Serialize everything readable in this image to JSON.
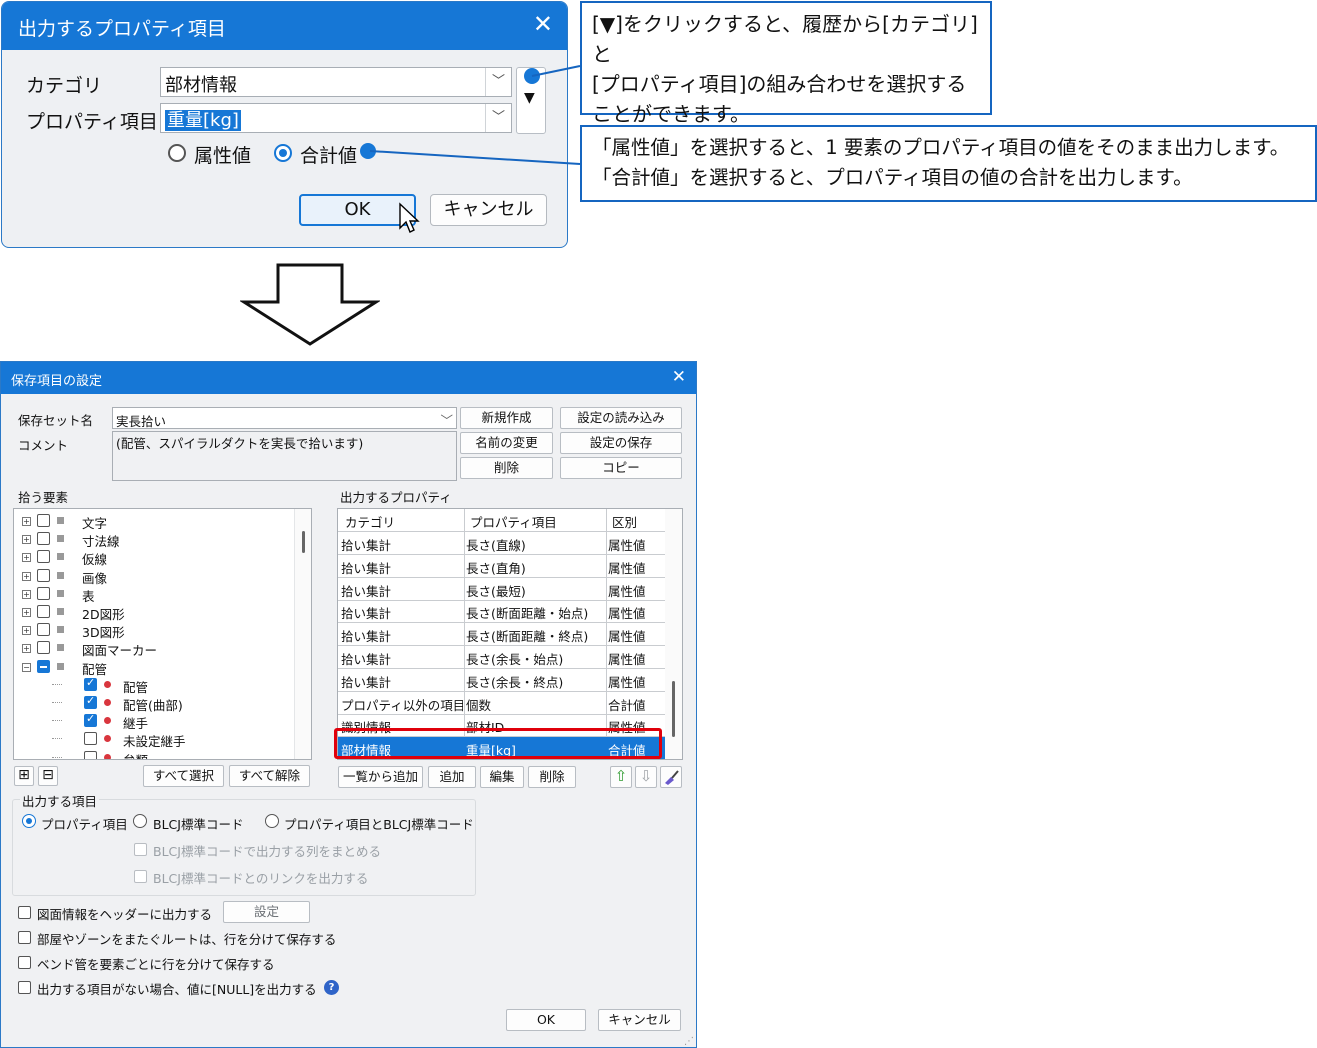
{
  "top_dialog": {
    "title": "出力するプロパティ項目",
    "close_glyph": "✕",
    "category_label": "カテゴリ",
    "category_value": "部材情報",
    "property_label": "プロパティ項目",
    "property_value": "重量[kg]",
    "history_arrow": "▼",
    "radio_attribute": "属性値",
    "radio_total": "合計値",
    "selected_radio": "合計値",
    "ok_label": "OK",
    "cancel_label": "キャンセル"
  },
  "callouts": {
    "history_line1": "[▼]をクリックすると、履歴から[カテゴリ]と",
    "history_line2": "[プロパティ項目]の組み合わせを選択する",
    "history_line3": "ことができます。",
    "total_line1": "「属性値」を選択すると、1 要素のプロパティ項目の値をそのまま出力します。",
    "total_line2": "「合計値」を選択すると、プロパティ項目の値の合計を出力します。"
  },
  "main_dialog": {
    "title": "保存項目の設定",
    "close_glyph": "✕",
    "save_set_label": "保存セット名",
    "save_set_value": "実長拾い",
    "comment_label": "コメント",
    "comment_value": "(配管、スパイラルダクトを実長で拾います)",
    "buttons": {
      "new": "新規作成",
      "load": "設定の読み込み",
      "rename": "名前の変更",
      "save_settings": "設定の保存",
      "delete": "削除",
      "copy": "コピー"
    },
    "pick_elements_label": "拾う要素",
    "tree": [
      {
        "label": "文字",
        "state": "off",
        "expander": "+"
      },
      {
        "label": "寸法線",
        "state": "off",
        "expander": "+"
      },
      {
        "label": "仮線",
        "state": "off",
        "expander": "+"
      },
      {
        "label": "画像",
        "state": "off",
        "expander": "+"
      },
      {
        "label": "表",
        "state": "off",
        "expander": "+"
      },
      {
        "label": "2D図形",
        "state": "off",
        "expander": "+"
      },
      {
        "label": "3D図形",
        "state": "off",
        "expander": "+"
      },
      {
        "label": "図面マーカー",
        "state": "off",
        "expander": "+"
      },
      {
        "label": "配管",
        "state": "partial",
        "expander": "−"
      },
      {
        "label": "配管",
        "state": "on",
        "child": true
      },
      {
        "label": "配管(曲部)",
        "state": "on",
        "child": true
      },
      {
        "label": "継手",
        "state": "on",
        "child": true
      },
      {
        "label": "未設定継手",
        "state": "off",
        "child": true
      },
      {
        "label": "弁類",
        "state": "off",
        "child": true
      }
    ],
    "expand_all_glyph": "⊞",
    "collapse_all_glyph": "⊟",
    "select_all": "すべて選択",
    "deselect_all": "すべて解除",
    "output_props_label": "出力するプロパティ",
    "columns": [
      "カテゴリ",
      "プロパティ項目",
      "区別"
    ],
    "rows": [
      [
        "拾い集計",
        "長さ(直線)",
        "属性値"
      ],
      [
        "拾い集計",
        "長さ(直角)",
        "属性値"
      ],
      [
        "拾い集計",
        "長さ(最短)",
        "属性値"
      ],
      [
        "拾い集計",
        "長さ(断面距離・始点)",
        "属性値"
      ],
      [
        "拾い集計",
        "長さ(断面距離・終点)",
        "属性値"
      ],
      [
        "拾い集計",
        "長さ(余長・始点)",
        "属性値"
      ],
      [
        "拾い集計",
        "長さ(余長・終点)",
        "属性値"
      ],
      [
        "プロパティ以外の項目",
        "個数",
        "合計値"
      ],
      [
        "識別情報",
        "部材ID",
        "属性値"
      ],
      [
        "部材情報",
        "重量[kg]",
        "合計値"
      ]
    ],
    "selected_row_index": 9,
    "list_buttons": {
      "add_from_list": "一覧から追加",
      "add": "追加",
      "edit": "編集",
      "delete": "削除"
    },
    "move_up_glyph": "⇧",
    "move_down_glyph": "⇩",
    "output_items_group": "出力する項目",
    "output_options": [
      "プロパティ項目",
      "BLCJ標準コード",
      "プロパティ項目とBLCJ標準コード"
    ],
    "output_selected": "プロパティ項目",
    "blcj_merge": "BLCJ標準コードで出力する列をまとめる",
    "blcj_link": "BLCJ標準コードとのリンクを出力する",
    "opt_header": "図面情報をヘッダーに出力する",
    "opt_header_button": "設定",
    "opt_route": "部屋やゾーンをまたぐルートは、行を分けて保存する",
    "opt_bend": "ベンド管を要素ごとに行を分けて保存する",
    "opt_null": "出力する項目がない場合、値に[NULL]を出力する",
    "help_glyph": "?",
    "ok_label": "OK",
    "cancel_label": "キャンセル"
  },
  "colors": {
    "accent": "#1677d6",
    "highlight_border": "#e0000b",
    "callout_border": "#1565c0"
  }
}
